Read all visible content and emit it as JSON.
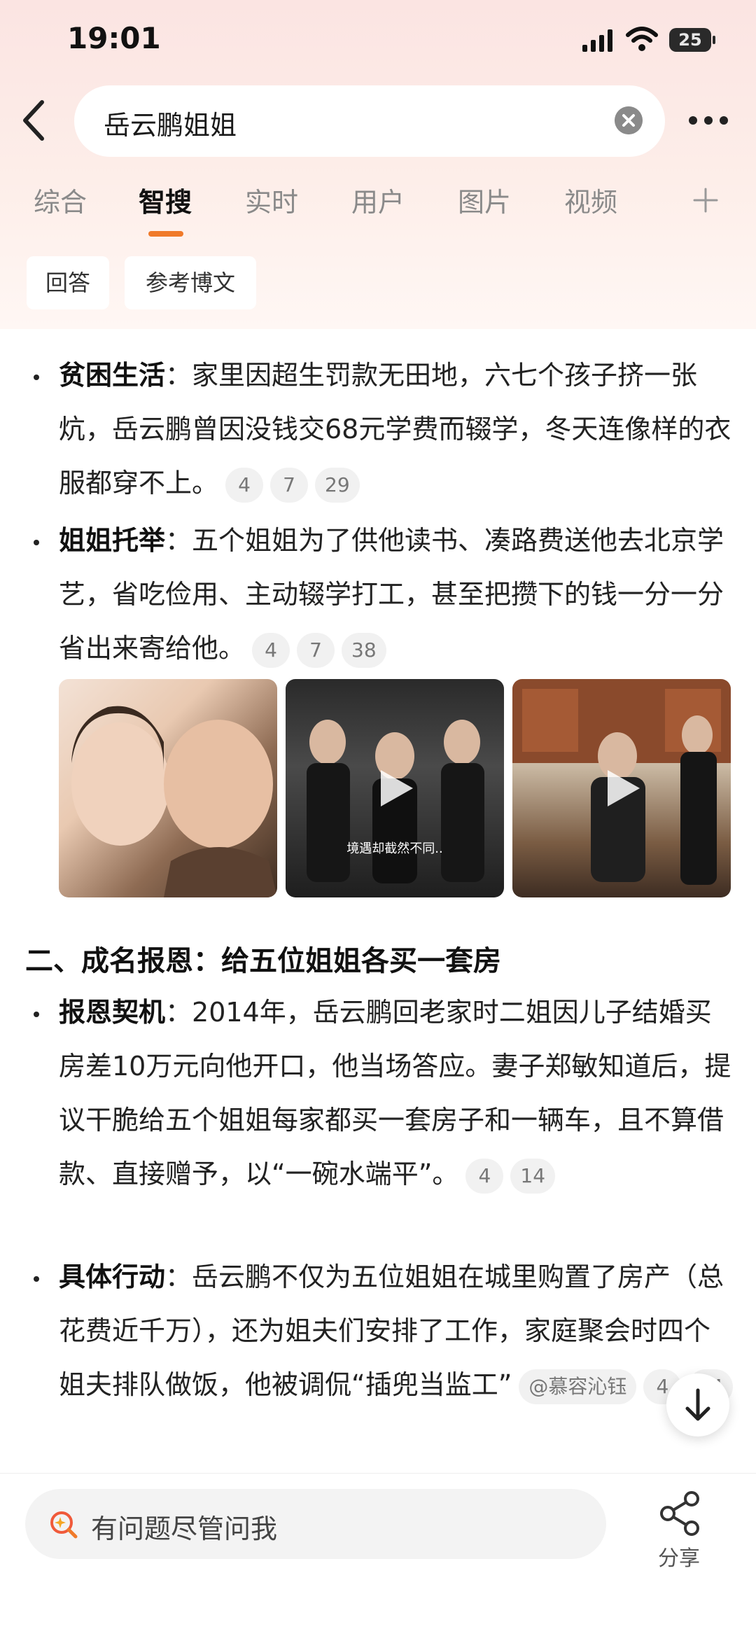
{
  "status_bar": {
    "time": "19:01",
    "battery": "25"
  },
  "search": {
    "query": "岳云鹏姐姐"
  },
  "tabs": [
    {
      "label": "综合"
    },
    {
      "label": "智搜"
    },
    {
      "label": "实时"
    },
    {
      "label": "用户"
    },
    {
      "label": "图片"
    },
    {
      "label": "视频"
    }
  ],
  "active_tab": "智搜",
  "chips": [
    {
      "label": "回答"
    },
    {
      "label": "参考博文"
    }
  ],
  "items": {
    "poverty": {
      "title": "贫困生活",
      "text": "：家里因超生罚款无田地，六七个孩子挤一张炕，岳云鹏曾因没钱交68元学费而辍学，冬天连像样的衣服都穿不上。",
      "cites": [
        "4",
        "7",
        "29"
      ]
    },
    "support": {
      "title": "姐姐托举",
      "text": "：五个姐姐为了供他读书、凑路费送他去北京学艺，省吃俭用、主动辍学打工，甚至把攒下的钱一分一分省出来寄给他。",
      "cites": [
        "4",
        "7",
        "38"
      ]
    },
    "repay": {
      "title": "报恩契机",
      "text": "：2014年，岳云鹏回老家时二姐因儿子结婚买房差10万元向他开口，他当场答应。妻子郑敏知道后，提议干脆给五个姐姐每家都买一套房子和一辆车，且不算借款、直接赠予，以“一碗水端平”。",
      "cites": [
        "4",
        "14"
      ]
    },
    "action": {
      "title": "具体行动",
      "text": "：岳云鹏不仅为五位姐姐在城里购置了房产（总花费近千万），还为姐夫们安排了工作，家庭聚会时四个姐夫排队做饭，他被调侃“插兜当监工”",
      "mention": "@慕容沁钰",
      "cites": [
        "4",
        "24"
      ]
    }
  },
  "media": [
    {
      "type": "photo"
    },
    {
      "type": "video",
      "caption": "境遇却截然不同.."
    },
    {
      "type": "video"
    }
  ],
  "section2_title": "二、成名报恩：给五位姐姐各买一套房",
  "bottom": {
    "ask_placeholder": "有问题尽管问我",
    "share_label": "分享"
  }
}
